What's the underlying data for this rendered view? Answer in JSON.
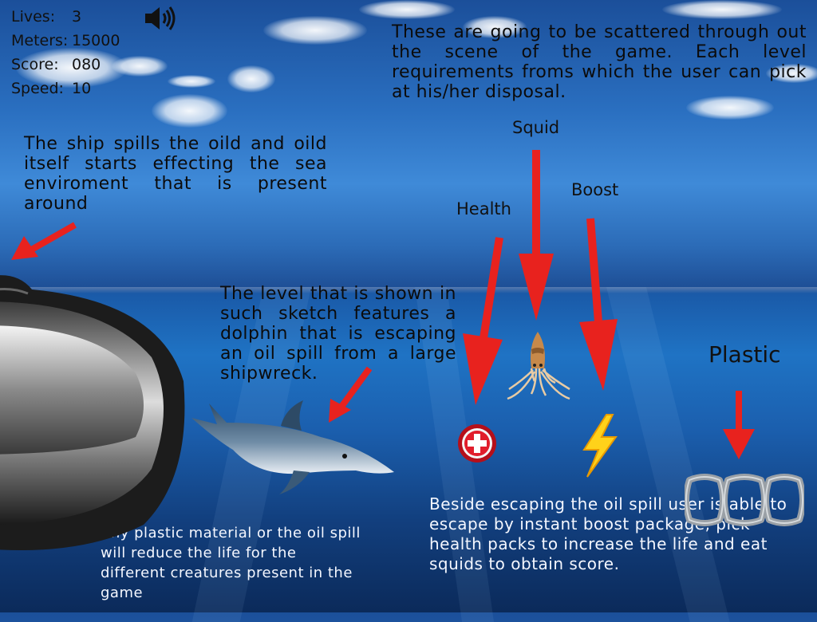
{
  "hud": {
    "lives_label": "Lives:",
    "lives_value": "3",
    "meters_label": "Meters:",
    "meters_value": "15000",
    "score_label": "Score:",
    "score_value": "080",
    "speed_label": "Speed:",
    "speed_value": "10",
    "sound_icon": "speaker-icon"
  },
  "notes": {
    "pickups": "These are going to be scattered through out the scene of the game. Each level requirements froms  which the user can pick at his/her disposal.",
    "ship": "The ship spills the oild and oild itself starts effecting the sea enviroment that is present around",
    "level": "The level that is shown in such sketch  features a dolphin that is escaping an oil spill from a large shipwreck.",
    "plastic_effect": "Any plastic material or the oil spill will reduce the life for the different creatures present in the game",
    "escape": "Beside escaping the oil spill user is able to escape by instant boost package, pick health packs to increase the life and eat squids to obtain score."
  },
  "labels": {
    "squid": "Squid",
    "boost": "Boost",
    "health": "Health",
    "plastic": "Plastic"
  },
  "colors": {
    "arrow": "#e8221e",
    "text_dark": "#0b0b0b",
    "text_light": "#f4f7ff"
  },
  "icons": {
    "health": "health-pack-icon",
    "squid": "squid-icon",
    "boost": "lightning-bolt-icon",
    "plastic": "plastic-rings-icon",
    "ship": "shipwreck-hull",
    "dolphin": "dolphin-character"
  }
}
